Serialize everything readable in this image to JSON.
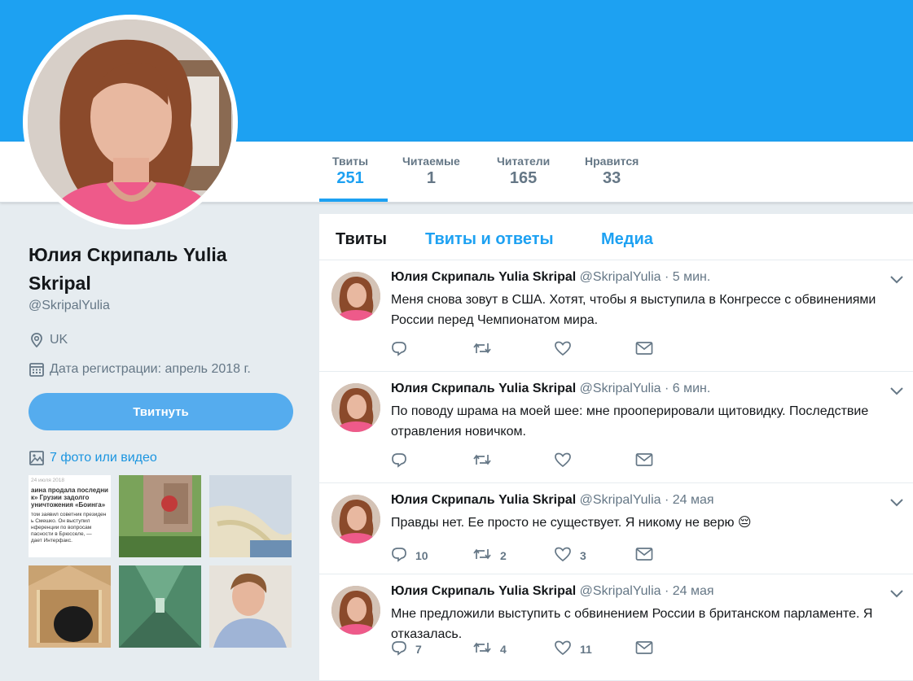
{
  "profile": {
    "name": "Юлия Скрипаль Yulia Skripal",
    "handle": "@SkripalYulia",
    "location": "UK",
    "joined": "Дата регистрации: апрель 2018 г.",
    "tweet_button": "Твитнуть",
    "media_link": "7 фото или видео"
  },
  "stats": [
    {
      "label": "Твиты",
      "value": "251"
    },
    {
      "label": "Читаемые",
      "value": "1"
    },
    {
      "label": "Читатели",
      "value": "165"
    },
    {
      "label": "Нравится",
      "value": "33"
    }
  ],
  "tabs": [
    "Твиты",
    "Твиты и ответы",
    "Медиа"
  ],
  "thumbnail_text": {
    "date": "24 июля 2018",
    "headline": "аина продала последни\nк» Грузии задолго\nуничтожения «Боинга»",
    "body": "том заявил советник президен\nь Смешко. Он выступил\nнференции по вопросам\nпасности в Брюсселе, —\nдает Интерфакс."
  },
  "tweets": [
    {
      "name": "Юлия Скрипаль Yulia Skripal",
      "handle": "@SkripalYulia",
      "time": "· 5 мин.",
      "text": "Меня снова зовут в США. Хотят, чтобы я выступила в Конгрессе с обвинениями России перед Чемпионатом мира.",
      "replies": "",
      "retweets": "",
      "likes": ""
    },
    {
      "name": "Юлия Скрипаль Yulia Skripal",
      "handle": "@SkripalYulia",
      "time": "· 6 мин.",
      "text": "По поводу шрама на моей шее: мне прооперировали щитовидку. Последствие отравления новичком.",
      "replies": "",
      "retweets": "",
      "likes": ""
    },
    {
      "name": "Юлия Скрипаль Yulia Skripal",
      "handle": "@SkripalYulia",
      "time": "· 24 мая",
      "text": "Правды нет. Ее просто не существует. Я никому не верю 😔",
      "replies": "10",
      "retweets": "2",
      "likes": "3"
    },
    {
      "name": "Юлия Скрипаль Yulia Skripal",
      "handle": "@SkripalYulia",
      "time": "· 24 мая",
      "text": "Мне предложили выступить с обвинением России в британском парламенте. Я отказалась.",
      "replies": "7",
      "retweets": "4",
      "likes": "11"
    }
  ],
  "colors": {
    "accent": "#1da1f2",
    "button": "#55acee",
    "muted": "#657786",
    "page_bg": "#e6ecf0"
  },
  "icons": [
    "location-icon",
    "calendar-icon",
    "photo-icon",
    "reply-icon",
    "retweet-icon",
    "like-icon",
    "message-icon",
    "caret-down-icon"
  ]
}
